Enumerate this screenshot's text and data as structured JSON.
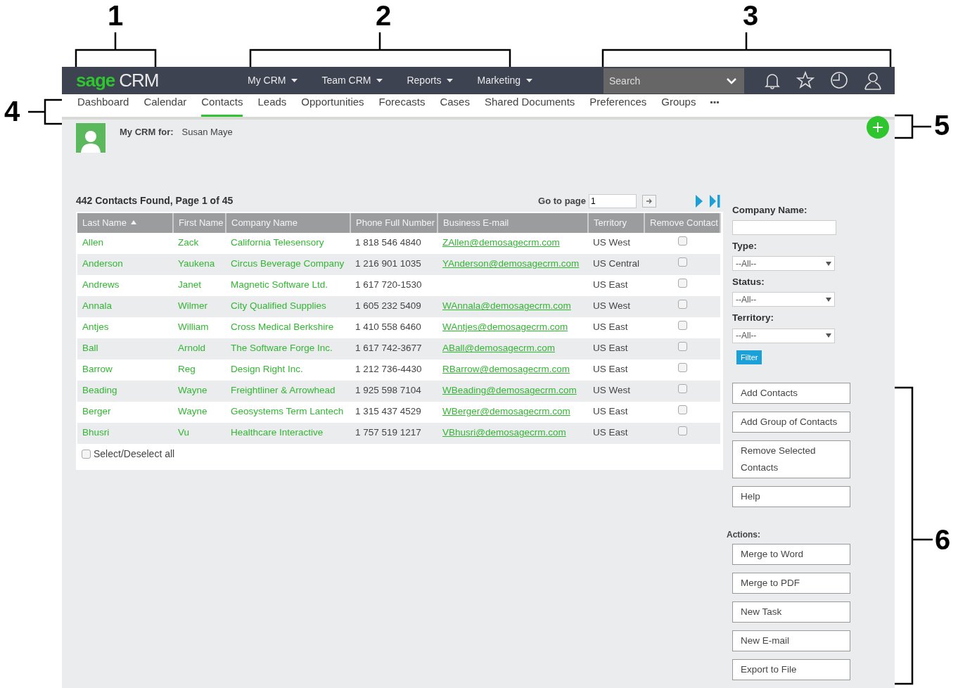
{
  "callouts": [
    {
      "label": "1"
    },
    {
      "label": "2"
    },
    {
      "label": "3"
    },
    {
      "label": "4"
    },
    {
      "label": "5"
    },
    {
      "label": "6"
    }
  ],
  "logo": {
    "brand": "sage",
    "product": "CRM"
  },
  "top_menu": [
    {
      "label": "My CRM"
    },
    {
      "label": "Team CRM"
    },
    {
      "label": "Reports"
    },
    {
      "label": "Marketing"
    }
  ],
  "search": {
    "placeholder": "Search"
  },
  "tabs": [
    {
      "label": "Dashboard",
      "selected": false
    },
    {
      "label": "Calendar",
      "selected": false
    },
    {
      "label": "Contacts",
      "selected": true
    },
    {
      "label": "Leads",
      "selected": false
    },
    {
      "label": "Opportunities",
      "selected": false
    },
    {
      "label": "Forecasts",
      "selected": false
    },
    {
      "label": "Cases",
      "selected": false
    },
    {
      "label": "Shared Documents",
      "selected": false
    },
    {
      "label": "Preferences",
      "selected": false
    },
    {
      "label": "Groups",
      "selected": false
    }
  ],
  "context": {
    "label": "My CRM for:",
    "user": "Susan Maye"
  },
  "results": {
    "summary": "442 Contacts Found, Page 1 of 45",
    "goto_label": "Go to page",
    "goto_value": "1"
  },
  "table": {
    "columns": [
      "Last Name",
      "First Name",
      "Company Name",
      "Phone Full Number",
      "Business E-mail",
      "Territory",
      "Remove Contact"
    ],
    "rows": [
      {
        "last": "Allen",
        "first": "Zack",
        "company": "California Telesensory",
        "phone": "1 818 546 4840",
        "email": "ZAllen@demosagecrm.com",
        "territory": "US West",
        "remove": false
      },
      {
        "last": "Anderson",
        "first": "Yaukena",
        "company": "Circus Beverage Company",
        "phone": "1 216 901 1035",
        "email": "YAnderson@demosagecrm.com",
        "territory": "US Central",
        "remove": false
      },
      {
        "last": "Andrews",
        "first": "Janet",
        "company": "Magnetic Software Ltd.",
        "phone": "1 617 720-1530",
        "territory": "US East",
        "remove": false
      },
      {
        "last": "Annala",
        "first": "Wilmer",
        "company": "City Qualified Supplies",
        "phone": "1 605 232 5409",
        "email": "WAnnala@demosagecrm.com",
        "territory": "US West",
        "remove": false
      },
      {
        "last": "Antjes",
        "first": "William",
        "company": "Cross Medical Berkshire",
        "phone": "1 410 558 6460",
        "email": "WAntjes@demosagecrm.com",
        "territory": "US East",
        "remove": false
      },
      {
        "last": "Ball",
        "first": "Arnold",
        "company": "The Software Forge Inc.",
        "phone": "1 617 742-3677",
        "email": "ABall@demosagecrm.com",
        "territory": "US East",
        "remove": false
      },
      {
        "last": "Barrow",
        "first": "Reg",
        "company": "Design Right Inc.",
        "phone": "1 212 736-4430",
        "email": "RBarrow@demosagecrm.com",
        "territory": "US East",
        "remove": false
      },
      {
        "last": "Beading",
        "first": "Wayne",
        "company": "Freightliner & Arrowhead",
        "phone": "1 925 598 7104",
        "email": "WBeading@demosagecrm.com",
        "territory": "US West",
        "remove": false
      },
      {
        "last": "Berger",
        "first": "Wayne",
        "company": "Geosystems Term Lantech",
        "phone": "1 315 437 4529",
        "email": "WBerger@demosagecrm.com",
        "territory": "US East",
        "remove": false
      },
      {
        "last": "Bhusri",
        "first": "Vu",
        "company": "Healthcare Interactive",
        "phone": "1 757 519 1217",
        "email": "VBhusri@demosagecrm.com",
        "territory": "US East",
        "remove": false
      }
    ],
    "select_all": {
      "label": "Select/Deselect all",
      "checked": false
    }
  },
  "filters": [
    {
      "label": "Company Name:",
      "kind": "text"
    },
    {
      "label": "Type:",
      "kind": "select",
      "value": "--All--"
    },
    {
      "label": "Status:",
      "kind": "select",
      "value": "--All--"
    },
    {
      "label": "Territory:",
      "kind": "select",
      "value": "--All--"
    }
  ],
  "filter_button": "Filter",
  "buttons": [
    "Add Contacts",
    "Add Group of Contacts",
    "Remove Selected Contacts",
    "Help"
  ],
  "actions_label": "Actions:",
  "actions": [
    "Merge to Word",
    "Merge to PDF",
    "New Task",
    "New E-mail",
    "Export to File"
  ]
}
